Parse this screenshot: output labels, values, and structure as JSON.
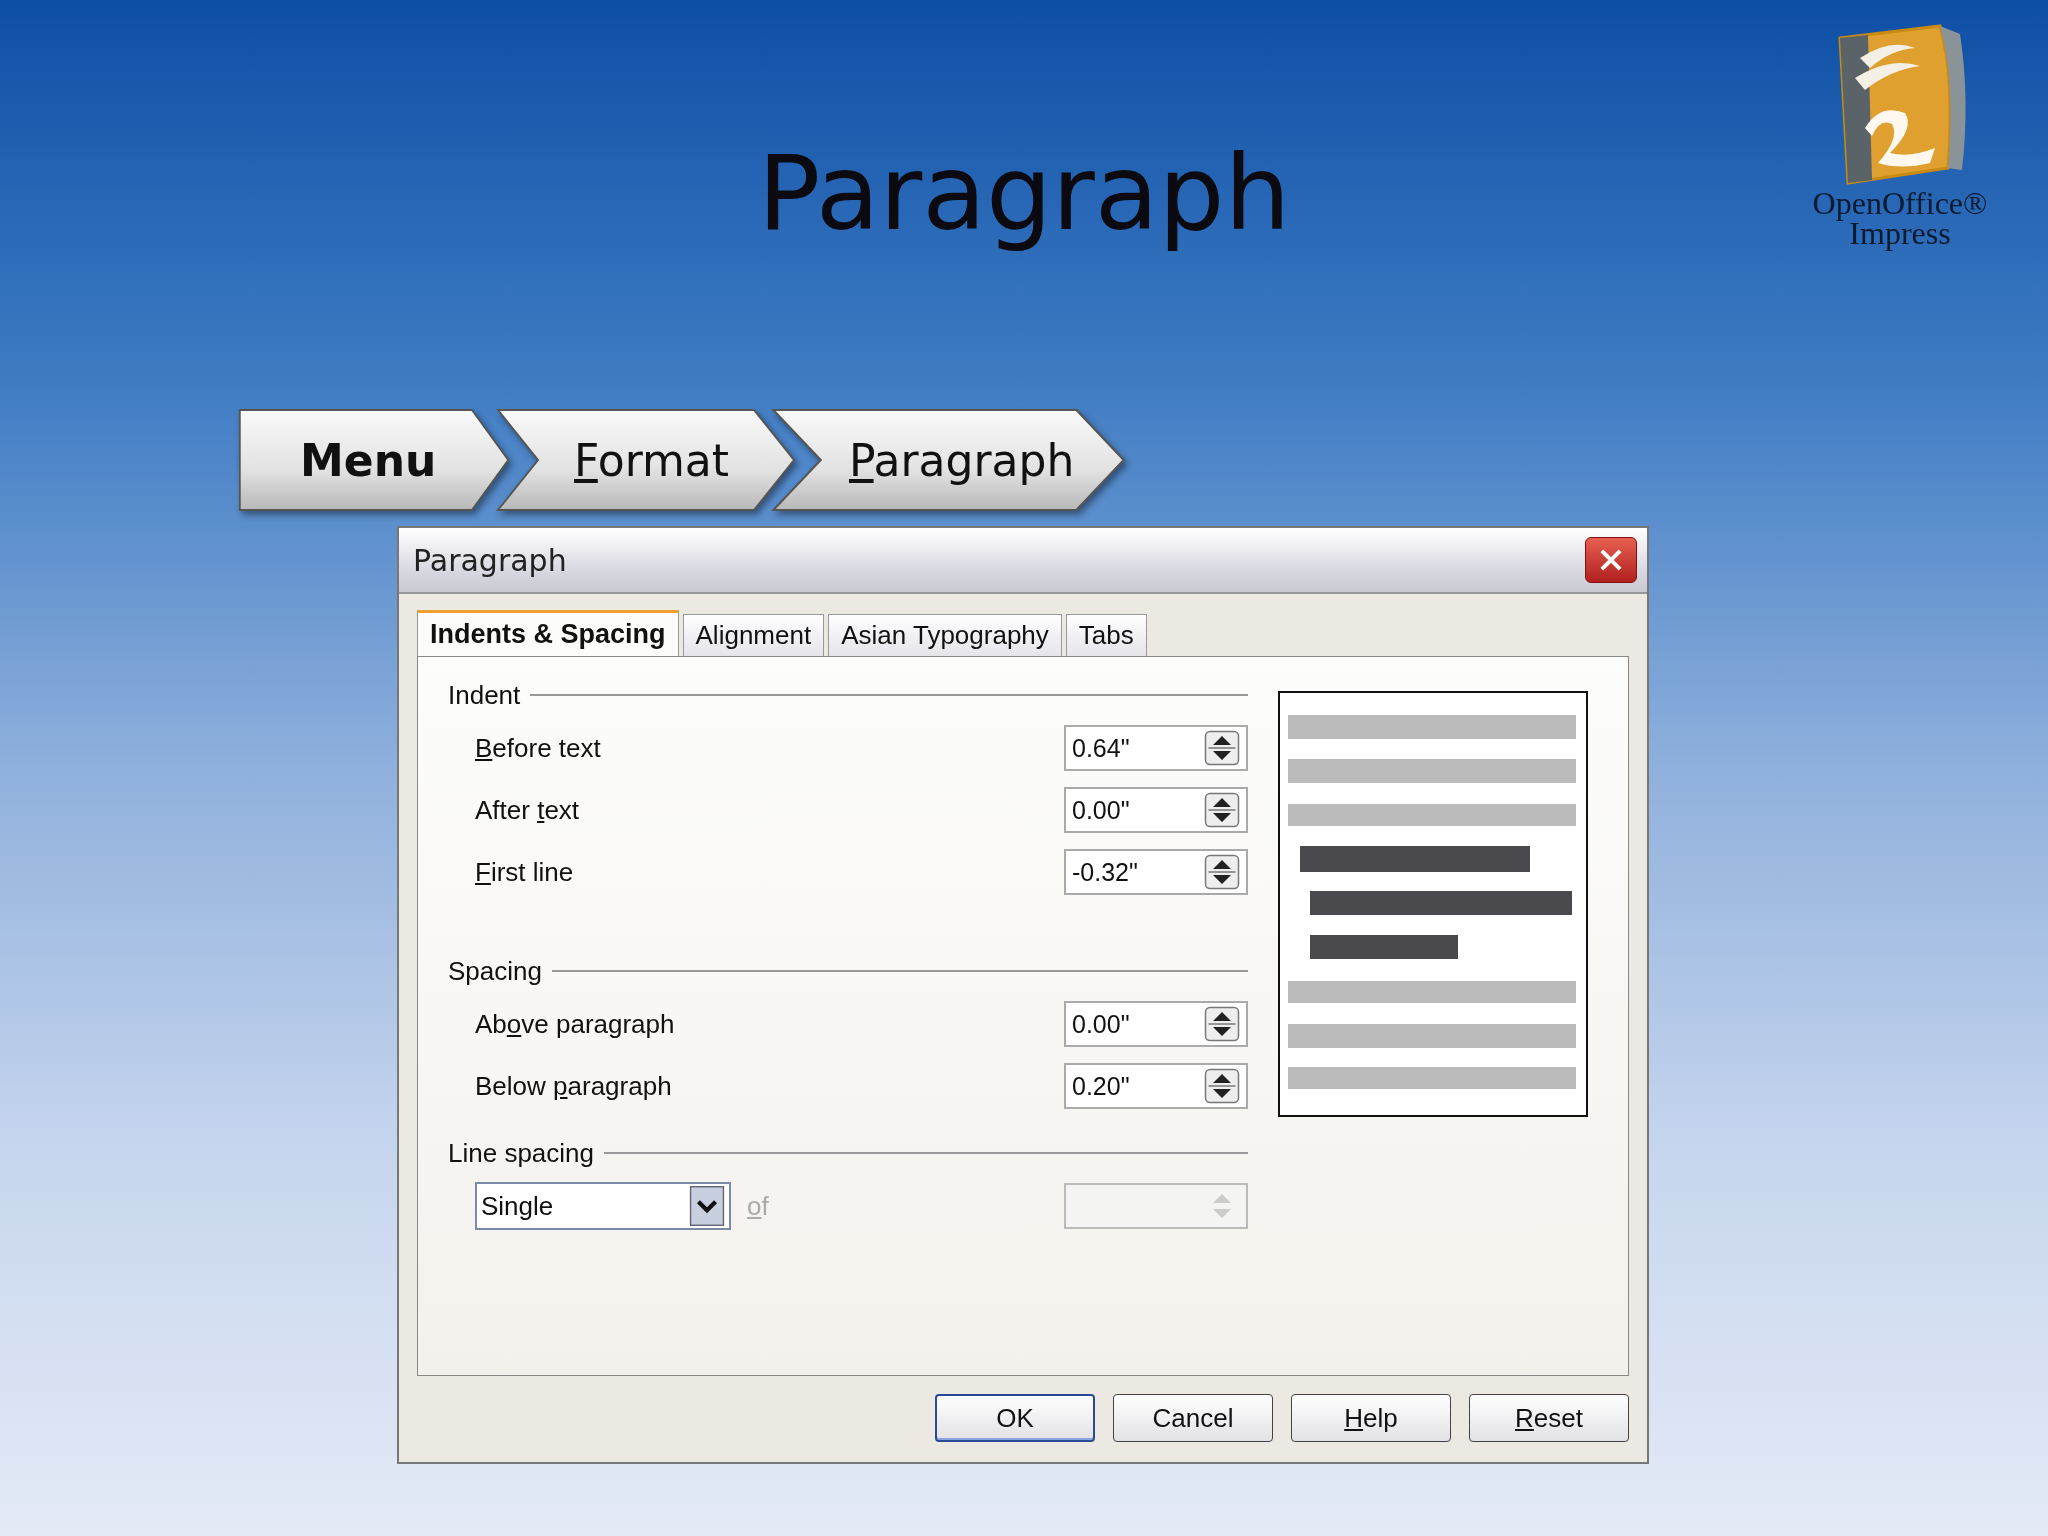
{
  "slide": {
    "title": "Paragraph",
    "logo": {
      "line_1": "OpenOffice®",
      "line_2": "Impress"
    }
  },
  "breadcrumb": [
    {
      "kind": "start",
      "label": {
        "pre": "Menu"
      }
    },
    {
      "kind": "step",
      "label": {
        "key": "F",
        "post": "ormat"
      }
    },
    {
      "kind": "step",
      "label": {
        "key": "P",
        "post": "aragraph"
      }
    }
  ],
  "dialog": {
    "title": "Paragraph",
    "tabs": [
      {
        "label": "Indents & Spacing",
        "selected": true
      },
      {
        "label": "Alignment",
        "selected": false
      },
      {
        "label": "Asian Typography",
        "selected": false
      },
      {
        "label": "Tabs",
        "selected": false
      }
    ],
    "groups": [
      {
        "heading": "Indent",
        "fields": [
          {
            "label": {
              "key": "B",
              "post": "efore text"
            },
            "value": "0.64\""
          },
          {
            "label": {
              "pre": "After ",
              "key": "t",
              "post": "ext"
            },
            "value": "0.00\""
          },
          {
            "label": {
              "key": "F",
              "post": "irst line"
            },
            "value": "-0.32\""
          }
        ]
      },
      {
        "heading": "Spacing",
        "fields": [
          {
            "label": {
              "pre": "Ab",
              "key": "o",
              "post": "ve paragraph"
            },
            "value": "0.00\""
          },
          {
            "label": {
              "pre": "Below ",
              "key": "p",
              "post": "aragraph"
            },
            "value": "0.20\""
          }
        ]
      }
    ],
    "line_spacing": {
      "heading": "Line spacing",
      "value": "Single",
      "of_label": {
        "key": "o",
        "post": "f"
      },
      "of_disabled": true,
      "amount_disabled": true
    },
    "buttons": [
      {
        "label": {
          "pre": "OK"
        },
        "default": true
      },
      {
        "label": {
          "pre": "Cancel"
        },
        "default": false
      },
      {
        "label": {
          "key": "H",
          "post": "elp"
        },
        "default": false
      },
      {
        "label": {
          "key": "R",
          "post": "eset"
        },
        "default": false
      }
    ]
  }
}
